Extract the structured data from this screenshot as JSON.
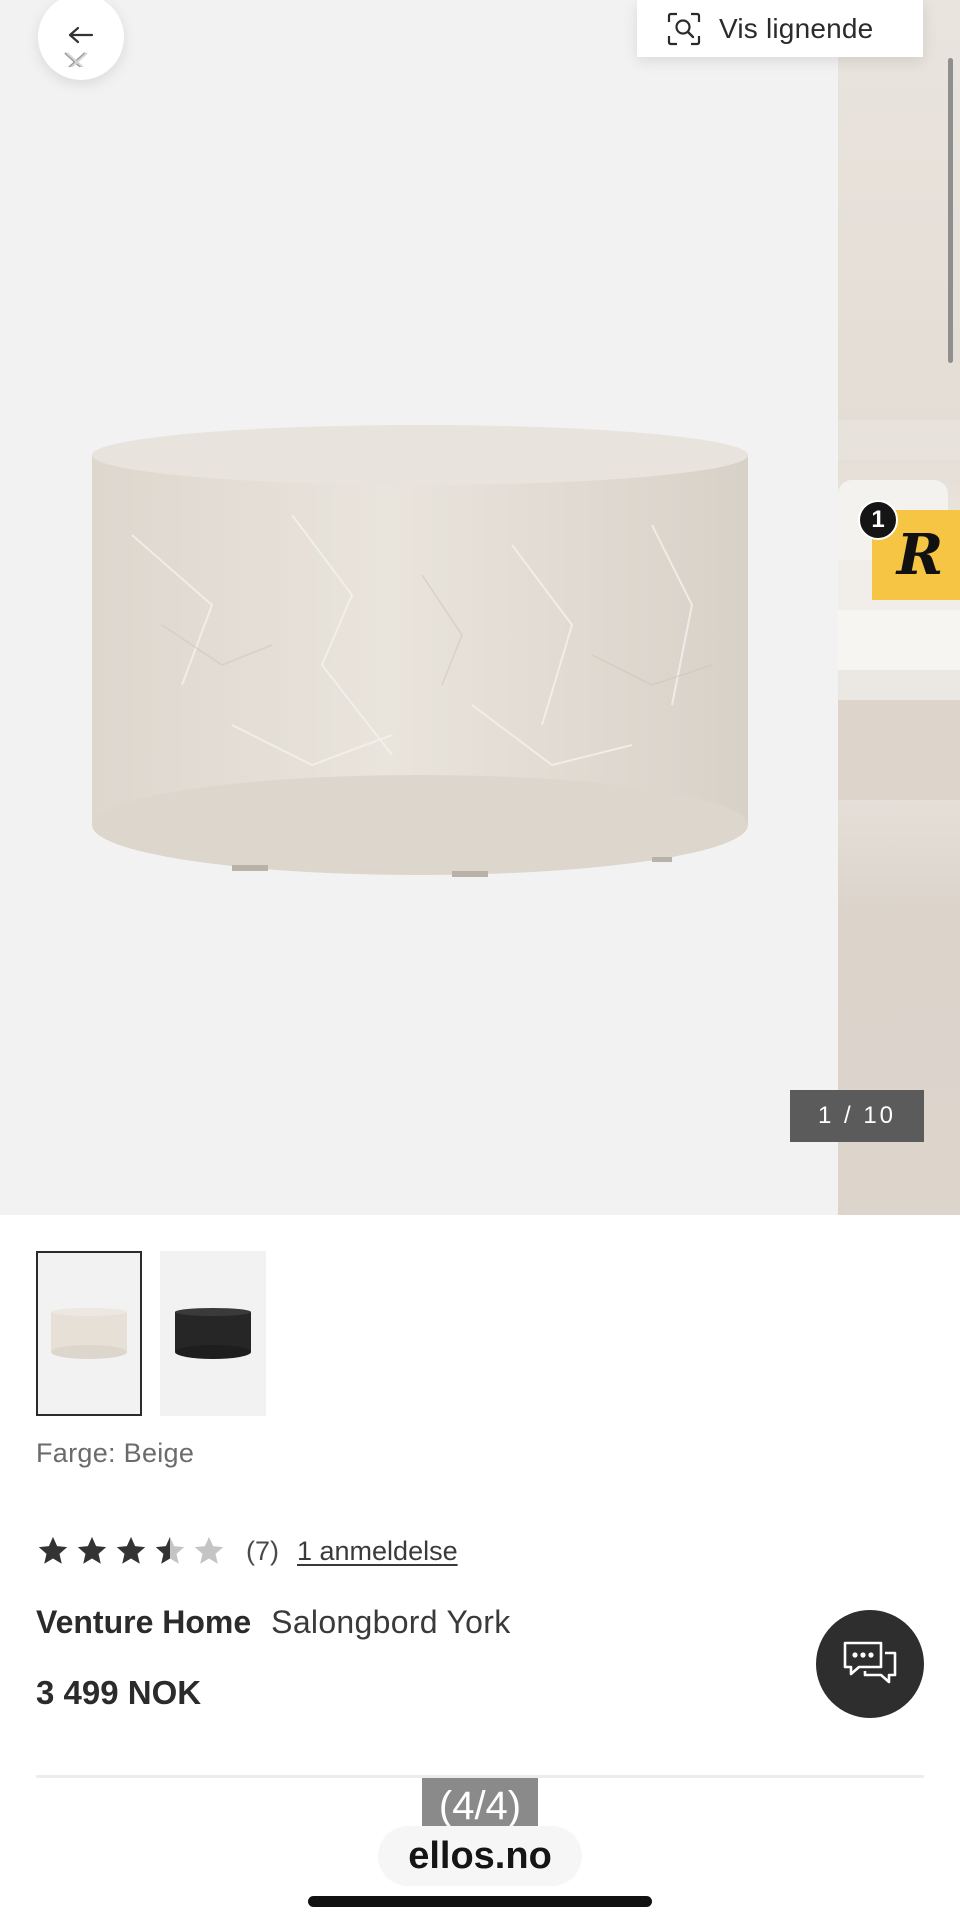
{
  "gallery": {
    "similar_label": "Vis lignende",
    "counter": "1 / 10",
    "notification_count": "1",
    "badge_letter": "R"
  },
  "product": {
    "color_label": "Farge: Beige",
    "rating": {
      "value": 3.5,
      "max": 5,
      "count": "(7)",
      "review_link": "1 anmeldelse"
    },
    "brand": "Venture Home",
    "name": "Salongbord York",
    "price": "3 499 NOK",
    "swatches": [
      {
        "color": "#e4ddd4",
        "selected": true
      },
      {
        "color": "#2a2a2a",
        "selected": false
      }
    ]
  },
  "overlay": {
    "page_marker": "(4/4)",
    "site": "ellos.no"
  },
  "colors": {
    "accent_badge": "#f6c544",
    "counter_bg": "#5b5b5b",
    "chat_bg": "#2e2e2e",
    "star_filled": "#333333",
    "star_empty": "#c4c4c4"
  },
  "icons": [
    "back-arrow-icon",
    "close-x-icon",
    "visual-search-icon",
    "star-icon",
    "chat-bubbles-icon"
  ]
}
